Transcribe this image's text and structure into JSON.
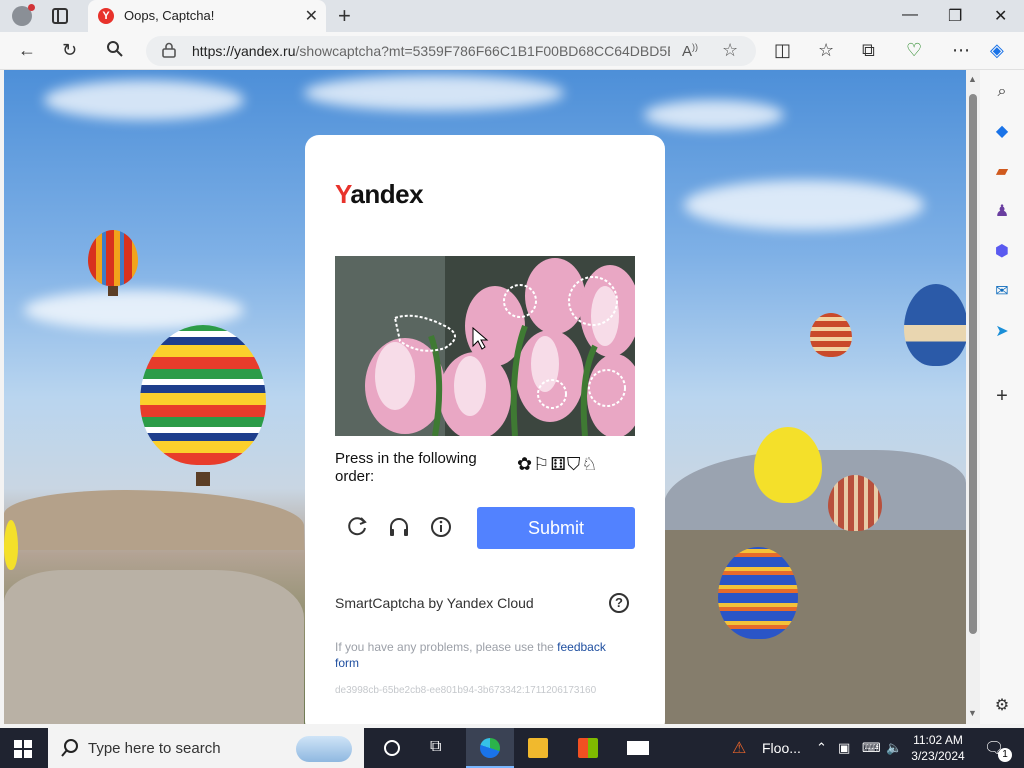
{
  "browser": {
    "tab": {
      "title": "Oops, Captcha!",
      "favicon_letter": "Y"
    },
    "address": {
      "host": "https://yandex.ru",
      "rest": "/showcaptcha?mt=5359F786F66C1B1F00BD68CC64DBD5E..."
    }
  },
  "captcha": {
    "logo_y": "Y",
    "logo_rest": "andex",
    "instruction": "Press in the following order:",
    "order_icons": "✿⚐⚅⛉♘",
    "submit_label": "Submit",
    "smartcaptcha_label": "SmartCaptcha by Yandex Cloud",
    "help_label": "?",
    "problems_text": "If you have any problems, please use the",
    "feedback_link": "feedback form",
    "token": "de3998cb-65be2cb8-ee801b94-3b673342:1711206173160"
  },
  "taskbar": {
    "search_placeholder": "Type here to search",
    "weather_label": "Floo...",
    "time": "11:02 AM",
    "date": "3/23/2024",
    "notification_count": "1"
  },
  "colors": {
    "accent": "#5282ff",
    "yandex_red": "#e8322b",
    "link": "#1f4fa0"
  }
}
